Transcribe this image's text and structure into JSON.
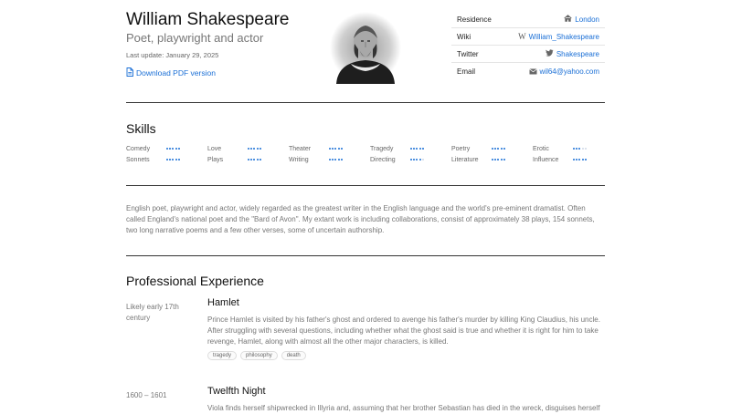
{
  "header": {
    "name": "William Shakespeare",
    "tagline": "Poet, playwright and actor",
    "last_update": "Last update: January 29, 2025",
    "pdf_label": "Download PDF version"
  },
  "info": [
    {
      "label": "Residence",
      "value": "London",
      "icon": "home-icon"
    },
    {
      "label": "Wiki",
      "value": "William_Shakespeare",
      "icon": "wikipedia-icon"
    },
    {
      "label": "Twitter",
      "value": "Shakespeare",
      "icon": "twitter-icon"
    },
    {
      "label": "Email",
      "value": "wil64@yahoo.com",
      "icon": "envelope-icon"
    }
  ],
  "skills_title": "Skills",
  "skills": [
    {
      "name": "Comedy",
      "level": 5
    },
    {
      "name": "Love",
      "level": 5
    },
    {
      "name": "Theater",
      "level": 5
    },
    {
      "name": "Tragedy",
      "level": 5
    },
    {
      "name": "Poetry",
      "level": 5
    },
    {
      "name": "Erotic",
      "level": 3
    },
    {
      "name": "Sonnets",
      "level": 5
    },
    {
      "name": "Plays",
      "level": 5
    },
    {
      "name": "Writing",
      "level": 5
    },
    {
      "name": "Directing",
      "level": 4
    },
    {
      "name": "Literature",
      "level": 5
    },
    {
      "name": "Influence",
      "level": 5
    }
  ],
  "bio": "English poet, playwright and actor, widely regarded as the greatest writer in the English language and the world's pre-eminent dramatist. Often called England's national poet and the \"Bard of Avon\". My extant work is including collaborations, consist of approximately 38 plays, 154 sonnets, two long narrative poems and a few other verses, some of uncertain authorship.",
  "experience_title": "Professional Experience",
  "experience": [
    {
      "date": "Likely early 17th century",
      "title": "Hamlet",
      "description": "Prince Hamlet is visited by his father's ghost and ordered to avenge his father's murder by killing King Claudius, his uncle. After struggling with several questions, including whether what the ghost said is true and whether it is right for him to take revenge, Hamlet, along with almost all the other major characters, is killed.",
      "tags": [
        "tragedy",
        "philosophy",
        "death"
      ]
    },
    {
      "date": "1600 – 1601",
      "title": "Twelfth Night",
      "description": "Viola finds herself shipwrecked in Illyria and, assuming that her brother Sebastian has died in the wreck, disguises herself",
      "tags": []
    }
  ],
  "colors": {
    "accent": "#1a6fd6",
    "text": "#222222",
    "muted": "#777777",
    "rule": "#333333"
  }
}
